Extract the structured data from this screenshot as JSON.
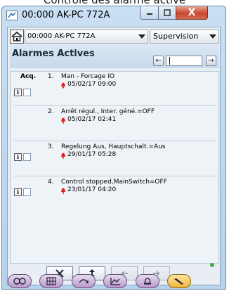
{
  "caption_partial": "Contrôle des alarme active",
  "window": {
    "title": "00:000 AK-PC 772A",
    "close_label": "X"
  },
  "selectors": {
    "device": "00:000 AK-PC 772A",
    "view": "Supervision"
  },
  "section": {
    "title": "Alarmes Actives"
  },
  "list": {
    "ack_header": "Acq.",
    "alarms": [
      {
        "num": "1.",
        "text": "Man - Forcage IO",
        "date": "05/02/17 09:00"
      },
      {
        "num": "2.",
        "text": "Arrêt régul., Inter. géné.=OFF",
        "date": "05/02/17 02:41"
      },
      {
        "num": "3.",
        "text": "Regelung Aus, Hauptschalt.=Aus",
        "date": "29/01/17 05:28"
      },
      {
        "num": "4.",
        "text": "Control stopped,MainSwitch=OFF",
        "date": "23/01/17 04:20"
      }
    ],
    "info_label": "i"
  },
  "icons": {
    "bell": "alarm-bell-icon",
    "home": "home-icon",
    "colors": {
      "bell": "#e1201f",
      "active_tool": "#f1b43a",
      "tool": "#b79acb"
    }
  }
}
